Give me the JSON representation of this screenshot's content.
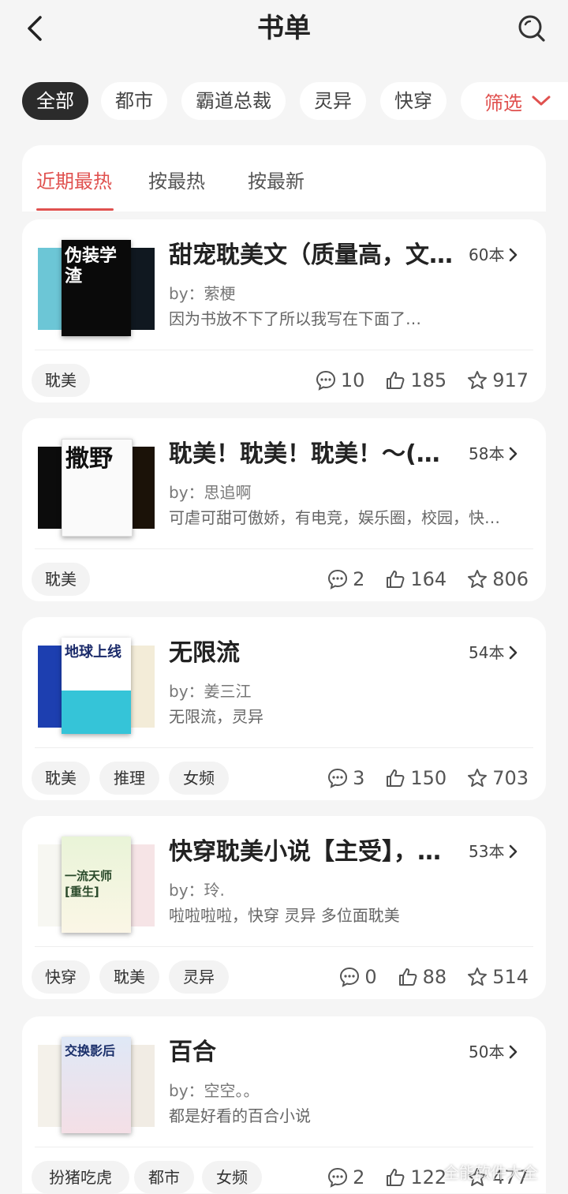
{
  "header": {
    "title": "书单"
  },
  "chips": [
    {
      "label": "全部",
      "active": true
    },
    {
      "label": "都市"
    },
    {
      "label": "霸道总裁"
    },
    {
      "label": "灵异"
    },
    {
      "label": "快穿"
    }
  ],
  "filter": {
    "label": "筛选"
  },
  "sort_tabs": [
    {
      "label": "近期最热",
      "active": true
    },
    {
      "label": "按最热"
    },
    {
      "label": "按最新"
    }
  ],
  "lists": [
    {
      "title": "甜宠耽美文（质量高，文…",
      "count": "60本",
      "author": "by：萦梗",
      "desc": "因为书放不下了所以我写在下面了…",
      "tags": [
        "耽美"
      ],
      "comments": "10",
      "likes": "185",
      "stars": "917",
      "cover_text": "伪装学渣"
    },
    {
      "title": "耽美！耽美！耽美！～(…",
      "count": "58本",
      "author": "by：思追啊",
      "desc": "可虐可甜可傲娇，有电竞，娱乐圈，校园，快…",
      "tags": [
        "耽美"
      ],
      "comments": "2",
      "likes": "164",
      "stars": "806",
      "cover_text": "撒野"
    },
    {
      "title": "无限流",
      "count": "54本",
      "author": "by：姜三江",
      "desc": "无限流，灵异",
      "tags": [
        "耽美",
        "推理",
        "女频"
      ],
      "comments": "3",
      "likes": "150",
      "stars": "703",
      "cover_text": "地球上线"
    },
    {
      "title": "快穿耽美小说【主受】，…",
      "count": "53本",
      "author": "by：玲.",
      "desc": "啦啦啦啦，快穿 灵异 多位面耽美",
      "tags": [
        "快穿",
        "耽美",
        "灵异"
      ],
      "comments": "0",
      "likes": "88",
      "stars": "514",
      "cover_text": "一流天师[重生]"
    },
    {
      "title": "百合",
      "count": "50本",
      "author": "by：空空。。",
      "desc": "都是好看的百合小说",
      "tags": [
        "扮猪吃虎",
        "都市",
        "女频"
      ],
      "comments": "2",
      "likes": "122",
      "stars": "477",
      "cover_text": "交换影后"
    }
  ],
  "watermark": "全能软件大全",
  "colors": {
    "accent": "#e0514f",
    "background": "#f5f5f5",
    "card": "#ffffff",
    "chip_active": "#2b2b2b"
  }
}
